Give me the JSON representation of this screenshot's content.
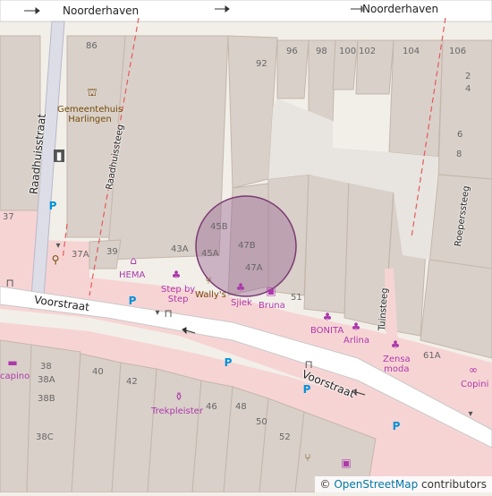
{
  "map": {
    "streets": {
      "noorderhaven_left": "Noorderhaven",
      "noorderhaven_right": "Noorderhaven",
      "raadhuisstraat": "Raadhuisstraat",
      "raadhuissteeg": "Raadhuissteeg",
      "voorstraat_left": "Voorstraat",
      "voorstraat_right": "Voorstraat",
      "tuinsteeg": "Tuinsteeg",
      "roeperssteeg": "Roeperssteeg"
    },
    "pois": {
      "gemeentehuis": "Gemeentehuis\nHarlingen",
      "hema": "HEMA",
      "step_by_step": "Step by\nStep",
      "wallys": "Wally's",
      "sjiek": "Sjiek",
      "bruna": "Bruna",
      "bonita": "BONITA",
      "arlina": "Arlina",
      "zensa": "Zensa\nmoda",
      "copini": "Copini",
      "kapino": "capino",
      "trekpleister": "Trekpleister"
    },
    "housenumbers": {
      "n86": "86",
      "n92": "92",
      "n96": "96",
      "n98": "98",
      "n100": "100",
      "n102": "102",
      "n104": "104",
      "n106": "106",
      "n2": "2",
      "n4": "4",
      "n6": "6",
      "n8": "8",
      "n37": "37",
      "n37a": "37A",
      "n39": "39",
      "n43a": "43A",
      "n45a": "45A",
      "n45b": "45B",
      "n47b": "47B",
      "n47a": "47A",
      "n51": "51",
      "n61a": "61A",
      "n38": "38",
      "n38a": "38A",
      "n38b": "38B",
      "n38c": "38C",
      "n40": "40",
      "n42": "42",
      "n46": "46",
      "n48": "48",
      "n50": "50",
      "n52": "52"
    },
    "colors": {
      "background": "#f2efe9",
      "building": "#d9d0c9",
      "building_stroke": "#c4b6ab",
      "pedestrian": "#f7d4d4",
      "road": "#dddde8",
      "road_white": "#ffffff",
      "boundary": "#e45a5a",
      "circle_fill": "#9b6b94",
      "circle_stroke": "#7a3a72",
      "poi_magenta": "#ac39ac",
      "parking_blue": "#0092da",
      "brown": "#734a08"
    }
  },
  "attribution": {
    "copyright": "©",
    "source": "OpenStreetMap",
    "suffix": "contributors"
  }
}
